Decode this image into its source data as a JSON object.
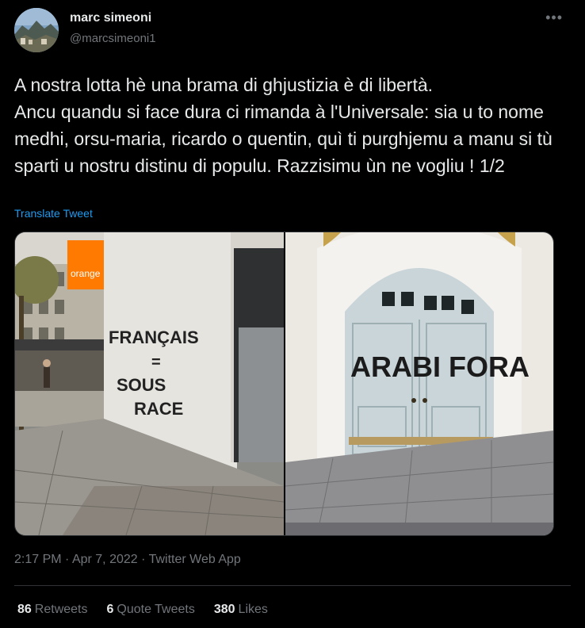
{
  "author": {
    "name": "marc simeoni",
    "handle": "@marcsimeoni1",
    "avatar_icon": "landscape-avatar"
  },
  "more_icon": "more-dots-icon",
  "tweet": {
    "text": "A nostra lotta hè una brama di ghjustizia è di libertà.\nAncu quandu si face dura ci rimanda à l'Universale: sia u to nome medhi, orsu-maria, ricardo o quentin, quì ti purghjemu a manu si tù sparti u nostru distinu di populu. Razzisimu ùn ne vogliu ! 1/2",
    "translate_label": "Translate Tweet"
  },
  "media": {
    "left_photo": {
      "shop_sign": "orange",
      "graffiti_lines": [
        "FRANÇAIS",
        "=",
        "SOUS",
        "RACE"
      ]
    },
    "right_photo": {
      "graffiti": "ARABI FORA"
    }
  },
  "meta": {
    "time": "2:17 PM",
    "date": "Apr 7, 2022",
    "source": "Twitter Web App",
    "separator": " · "
  },
  "stats": {
    "retweets_count": "86",
    "retweets_label": "Retweets",
    "quotes_count": "6",
    "quotes_label": "Quote Tweets",
    "likes_count": "380",
    "likes_label": "Likes"
  },
  "colors": {
    "background": "#000000",
    "text": "#e7e9ea",
    "secondary": "#71767b",
    "link": "#1d9bf0",
    "border": "#2f3336"
  }
}
